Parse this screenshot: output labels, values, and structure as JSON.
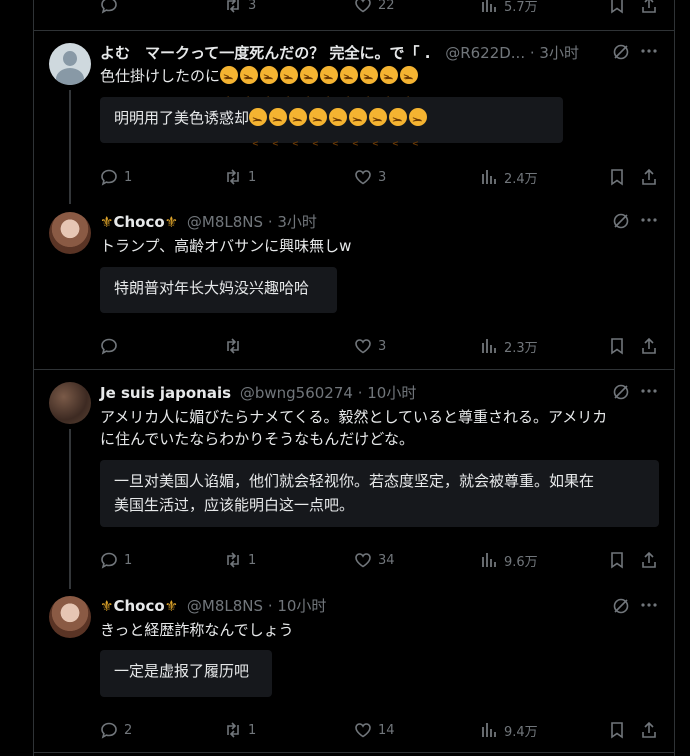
{
  "top_actions": {
    "replies": "",
    "retweets": "3",
    "likes": "22",
    "views": "5.7万"
  },
  "posts": [
    {
      "name": "よむ　マークって一度死んだの？ 完全に。で「 .",
      "handle": "@R622D...",
      "time": "· 3小时",
      "text": "色仕掛けしたのに",
      "emoji_count": 10,
      "translation": "明明用了美色诱惑却",
      "translation_emoji_count": 9,
      "actions": {
        "replies": "1",
        "retweets": "1",
        "likes": "3",
        "views": "2.4万"
      }
    },
    {
      "name": "Choco",
      "handle": "@M8L8NS",
      "time": "· 3小时",
      "text": "トランプ、高齢オバサンに興味無しw",
      "translation": "特朗普对年长大妈没兴趣哈哈",
      "actions": {
        "replies": "",
        "retweets": "",
        "likes": "3",
        "views": "2.3万"
      }
    },
    {
      "name": "Je suis japonais",
      "handle": "@bwng560274",
      "time": "· 10小时",
      "text_line1": "アメリカ人に媚びたらナメてくる。毅然としていると尊重される。アメリカ",
      "text_line2": "に住んでいたならわかりそうなもんだけどな。",
      "translation_line1": "一旦对美国人谄媚，他们就会轻视你。若态度坚定，就会被尊重。如果在",
      "translation_line2": "美国生活过，应该能明白这一点吧。",
      "actions": {
        "replies": "1",
        "retweets": "1",
        "likes": "34",
        "views": "9.6万"
      }
    },
    {
      "name": "Choco",
      "handle": "@M8L8NS",
      "time": "· 10小时",
      "text": "きっと経歴詐称なんでしょう",
      "translation": "一定是虚报了履历吧",
      "actions": {
        "replies": "2",
        "retweets": "1",
        "likes": "14",
        "views": "9.4万"
      }
    }
  ],
  "icons": [
    "reply-icon",
    "retweet-icon",
    "like-icon",
    "views-icon",
    "bookmark-icon",
    "share-icon",
    "grok-icon",
    "more-icon",
    "crown-emblem-icon",
    "persevering-face-emoji"
  ]
}
